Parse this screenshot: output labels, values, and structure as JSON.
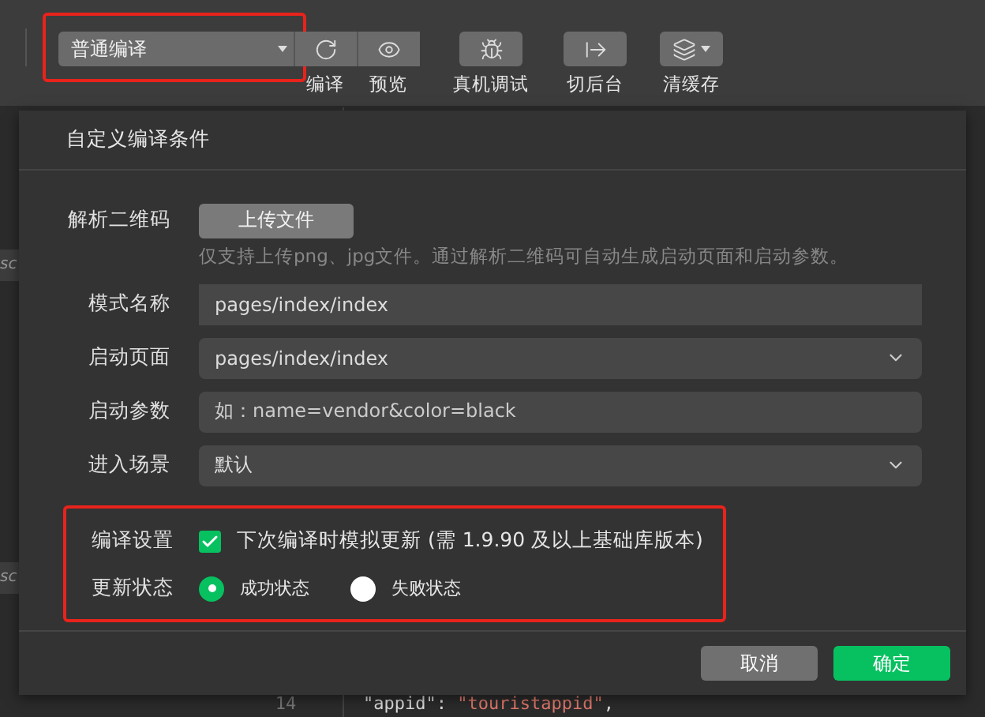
{
  "toolbar": {
    "mode_select": "普通编译",
    "buttons": [
      {
        "kind": "compile",
        "label": "编译"
      },
      {
        "kind": "preview",
        "label": "预览"
      },
      {
        "kind": "debug",
        "label": "真机调试"
      },
      {
        "kind": "background",
        "label": "切后台"
      },
      {
        "kind": "cache",
        "label": "清缓存"
      }
    ]
  },
  "side_fragments": [
    "sc",
    "sc"
  ],
  "editor": {
    "line_number": "14",
    "code_key": "\"appid\"",
    "code_colon": ": ",
    "code_value": "\"touristappid\"",
    "code_end": ","
  },
  "dialog": {
    "title": "自定义编译条件",
    "qr": {
      "label": "解析二维码",
      "button": "上传文件",
      "hint": "仅支持上传png、jpg文件。通过解析二维码可自动生成启动页面和启动参数。"
    },
    "fields": [
      {
        "kind": "input",
        "label": "模式名称",
        "value": "pages/index/index"
      },
      {
        "kind": "select",
        "label": "启动页面",
        "value": "pages/index/index"
      },
      {
        "kind": "input",
        "label": "启动参数",
        "placeholder": "如：name=vendor&color=black"
      },
      {
        "kind": "select",
        "label": "进入场景",
        "value": "默认"
      }
    ],
    "compile_setting": {
      "label": "编译设置",
      "checkbox": {
        "label": "下次编译时模拟更新 (需 1.9.90 及以上基础库版本)",
        "checked": true
      }
    },
    "update_state": {
      "label": "更新状态",
      "options": [
        {
          "label": "成功状态",
          "selected": true
        },
        {
          "label": "失败状态",
          "selected": false
        }
      ]
    },
    "buttons": [
      {
        "kind": "secondary",
        "label": "取消"
      },
      {
        "kind": "primary",
        "label": "确定"
      }
    ]
  }
}
